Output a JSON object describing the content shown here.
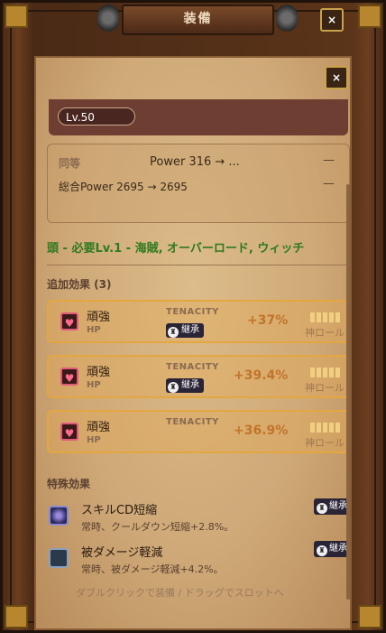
{
  "window": {
    "title": "装備",
    "close_label": "×"
  },
  "panel": {
    "close_label": "×"
  },
  "level": {
    "label": "Lv.50"
  },
  "comparison": {
    "same_label": "同等",
    "power": "Power 316 → ...",
    "total": "総合Power 2695 → 2695",
    "dash1": "—",
    "dash2": "—"
  },
  "item": {
    "headline": "頭 - 必要Lv.1 - 海賊, オーバーロード, ウィッチ"
  },
  "extra_effects": {
    "title": "追加効果 (3)",
    "rows": [
      {
        "name": "頑強",
        "stat": "HP",
        "tag": "TENACITY",
        "inherit": "継承",
        "value": "+37%",
        "god": "神ロール"
      },
      {
        "name": "頑強",
        "stat": "HP",
        "tag": "TENACITY",
        "inherit": "継承",
        "value": "+39.4%",
        "god": "神ロール"
      },
      {
        "name": "頑強",
        "stat": "HP",
        "tag": "TENACITY",
        "inherit": "",
        "value": "+36.9%",
        "god": "神ロール"
      }
    ]
  },
  "special_effects": {
    "title": "特殊効果",
    "items": [
      {
        "name": "スキルCD短縮",
        "desc": "常時、クールダウン短縮+2.8%。",
        "inherit": "継承"
      },
      {
        "name": "被ダメージ軽減",
        "desc": "常時、被ダメージ軽減+4.2%。",
        "inherit": "継承"
      }
    ]
  },
  "hint": "ダブルクリックで装備 / ドラッグでスロットへ",
  "colors": {
    "accent_green": "#2e7a1e",
    "value_orange": "#c2742a",
    "row_border": "#e3a640"
  }
}
